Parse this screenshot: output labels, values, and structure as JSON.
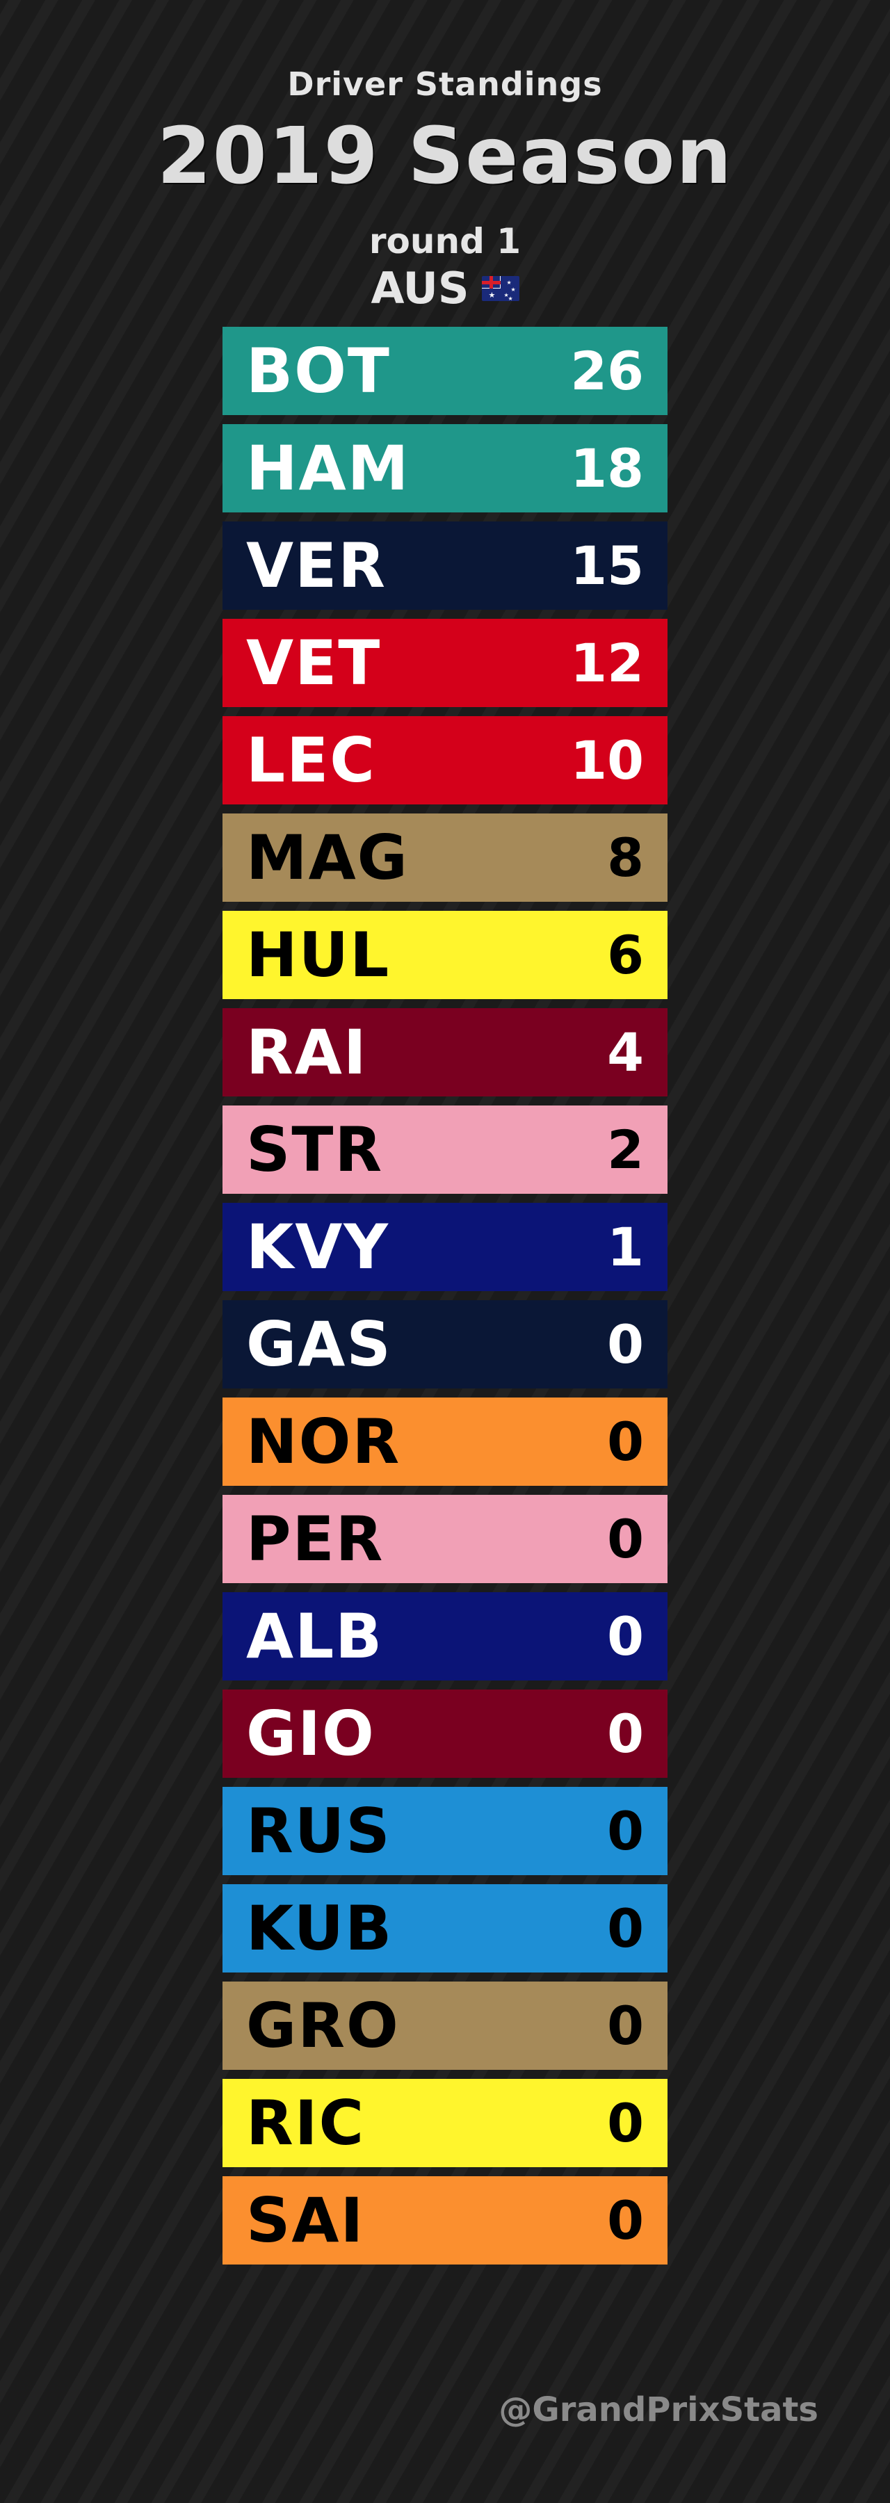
{
  "header": {
    "subtitle": "Driver Standings",
    "title": "2019 Season",
    "round": "round 1",
    "race": "AUS",
    "flag_icon": "australia-flag-icon"
  },
  "standings": [
    {
      "code": "BOT",
      "points": "26",
      "bg": "#1f978a",
      "fg": "#ffffff"
    },
    {
      "code": "HAM",
      "points": "18",
      "bg": "#1f978a",
      "fg": "#ffffff"
    },
    {
      "code": "VER",
      "points": "15",
      "bg": "#0a1736",
      "fg": "#ffffff"
    },
    {
      "code": "VET",
      "points": "12",
      "bg": "#d4001a",
      "fg": "#ffffff"
    },
    {
      "code": "LEC",
      "points": "10",
      "bg": "#d4001a",
      "fg": "#ffffff"
    },
    {
      "code": "MAG",
      "points": "8",
      "bg": "#a68a59",
      "fg": "#000000"
    },
    {
      "code": "HUL",
      "points": "6",
      "bg": "#fff52d",
      "fg": "#000000"
    },
    {
      "code": "RAI",
      "points": "4",
      "bg": "#7a0020",
      "fg": "#ffffff"
    },
    {
      "code": "STR",
      "points": "2",
      "bg": "#f1a0b6",
      "fg": "#000000"
    },
    {
      "code": "KVY",
      "points": "1",
      "bg": "#0b1477",
      "fg": "#ffffff"
    },
    {
      "code": "GAS",
      "points": "0",
      "bg": "#0a1736",
      "fg": "#ffffff"
    },
    {
      "code": "NOR",
      "points": "0",
      "bg": "#fb8f2f",
      "fg": "#000000"
    },
    {
      "code": "PER",
      "points": "0",
      "bg": "#f1a0b6",
      "fg": "#000000"
    },
    {
      "code": "ALB",
      "points": "0",
      "bg": "#0b1477",
      "fg": "#ffffff"
    },
    {
      "code": "GIO",
      "points": "0",
      "bg": "#7a0020",
      "fg": "#ffffff"
    },
    {
      "code": "RUS",
      "points": "0",
      "bg": "#1e8fd5",
      "fg": "#000000"
    },
    {
      "code": "KUB",
      "points": "0",
      "bg": "#1e8fd5",
      "fg": "#000000"
    },
    {
      "code": "GRO",
      "points": "0",
      "bg": "#a68a59",
      "fg": "#000000"
    },
    {
      "code": "RIC",
      "points": "0",
      "bg": "#fff52d",
      "fg": "#000000"
    },
    {
      "code": "SAI",
      "points": "0",
      "bg": "#fb8f2f",
      "fg": "#000000"
    }
  ],
  "footer": {
    "handle": "@GrandPrixStats"
  }
}
